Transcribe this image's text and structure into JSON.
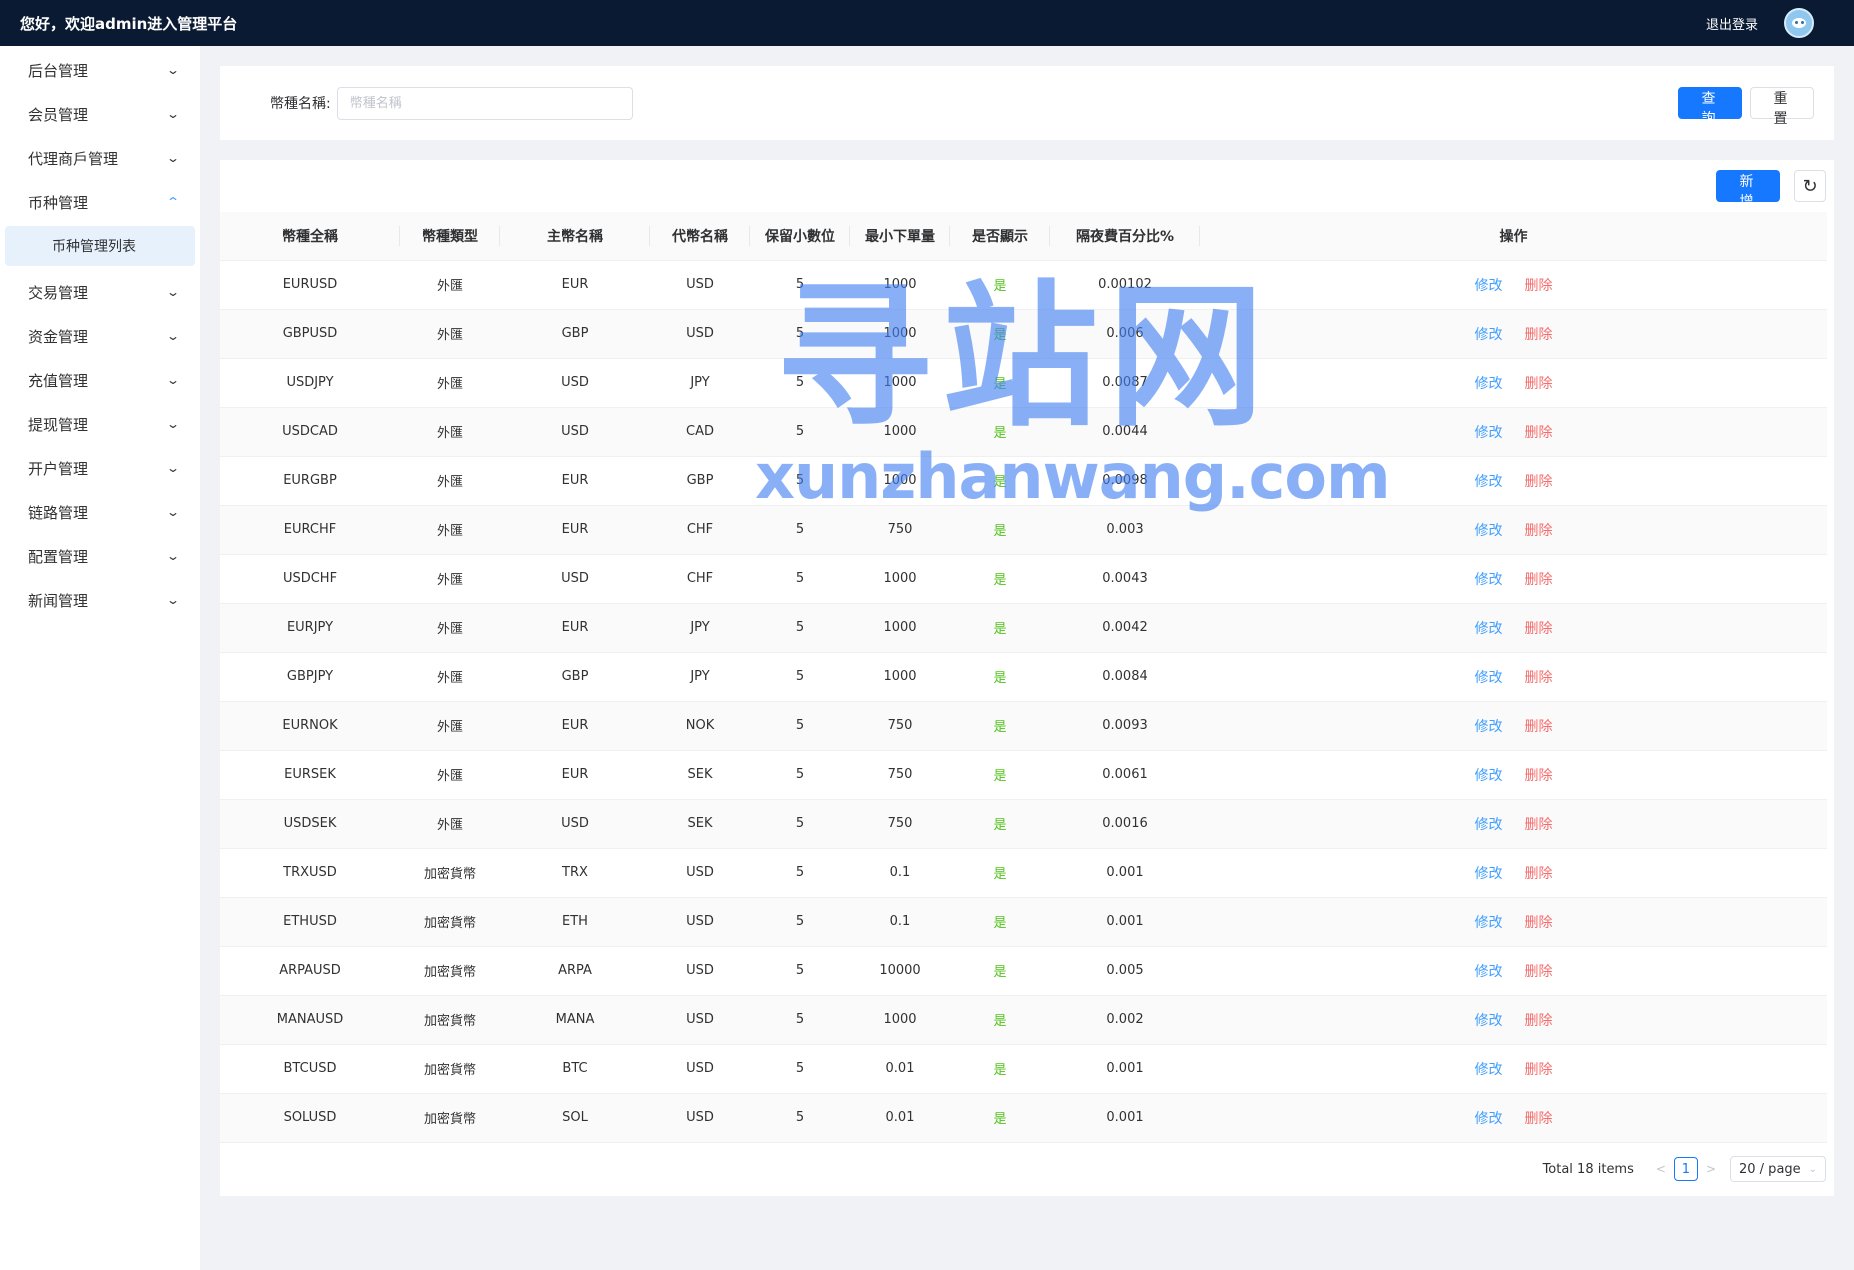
{
  "header": {
    "welcome": "您好，欢迎admin进入管理平台",
    "logout": "退出登录"
  },
  "sidebar": {
    "items": [
      {
        "label": "后台管理",
        "expanded": false
      },
      {
        "label": "会员管理",
        "expanded": false
      },
      {
        "label": "代理商戶管理",
        "expanded": false
      },
      {
        "label": "币种管理",
        "expanded": true
      },
      {
        "label": "交易管理",
        "expanded": false
      },
      {
        "label": "资金管理",
        "expanded": false
      },
      {
        "label": "充值管理",
        "expanded": false
      },
      {
        "label": "提现管理",
        "expanded": false
      },
      {
        "label": "开户管理",
        "expanded": false
      },
      {
        "label": "链路管理",
        "expanded": false
      },
      {
        "label": "配置管理",
        "expanded": false
      },
      {
        "label": "新闻管理",
        "expanded": false
      }
    ],
    "sub_active": "币种管理列表"
  },
  "search": {
    "label": "幣種名稱:",
    "placeholder": "幣種名稱",
    "query_label": "查詢",
    "reset_label": "重置"
  },
  "toolbar": {
    "add_label": "新增",
    "refresh_icon": "refresh-icon"
  },
  "table": {
    "columns": [
      "幣種全稱",
      "幣種類型",
      "主幣名稱",
      "代幣名稱",
      "保留小數位",
      "最小下單量",
      "是否顯示",
      "隔夜費百分比%",
      "操作"
    ],
    "edit_label": "修改",
    "delete_label": "删除",
    "rows": [
      [
        "EURUSD",
        "外匯",
        "EUR",
        "USD",
        "5",
        "1000",
        "是",
        "0.00102"
      ],
      [
        "GBPUSD",
        "外匯",
        "GBP",
        "USD",
        "5",
        "1000",
        "是",
        "0.006"
      ],
      [
        "USDJPY",
        "外匯",
        "USD",
        "JPY",
        "5",
        "1000",
        "是",
        "0.0087"
      ],
      [
        "USDCAD",
        "外匯",
        "USD",
        "CAD",
        "5",
        "1000",
        "是",
        "0.0044"
      ],
      [
        "EURGBP",
        "外匯",
        "EUR",
        "GBP",
        "5",
        "1000",
        "是",
        "0.0098"
      ],
      [
        "EURCHF",
        "外匯",
        "EUR",
        "CHF",
        "5",
        "750",
        "是",
        "0.003"
      ],
      [
        "USDCHF",
        "外匯",
        "USD",
        "CHF",
        "5",
        "1000",
        "是",
        "0.0043"
      ],
      [
        "EURJPY",
        "外匯",
        "EUR",
        "JPY",
        "5",
        "1000",
        "是",
        "0.0042"
      ],
      [
        "GBPJPY",
        "外匯",
        "GBP",
        "JPY",
        "5",
        "1000",
        "是",
        "0.0084"
      ],
      [
        "EURNOK",
        "外匯",
        "EUR",
        "NOK",
        "5",
        "750",
        "是",
        "0.0093"
      ],
      [
        "EURSEK",
        "外匯",
        "EUR",
        "SEK",
        "5",
        "750",
        "是",
        "0.0061"
      ],
      [
        "USDSEK",
        "外匯",
        "USD",
        "SEK",
        "5",
        "750",
        "是",
        "0.0016"
      ],
      [
        "TRXUSD",
        "加密貨幣",
        "TRX",
        "USD",
        "5",
        "0.1",
        "是",
        "0.001"
      ],
      [
        "ETHUSD",
        "加密貨幣",
        "ETH",
        "USD",
        "5",
        "0.1",
        "是",
        "0.001"
      ],
      [
        "ARPAUSD",
        "加密貨幣",
        "ARPA",
        "USD",
        "5",
        "10000",
        "是",
        "0.005"
      ],
      [
        "MANAUSD",
        "加密貨幣",
        "MANA",
        "USD",
        "5",
        "1000",
        "是",
        "0.002"
      ],
      [
        "BTCUSD",
        "加密貨幣",
        "BTC",
        "USD",
        "5",
        "0.01",
        "是",
        "0.001"
      ],
      [
        "SOLUSD",
        "加密貨幣",
        "SOL",
        "USD",
        "5",
        "0.01",
        "是",
        "0.001"
      ]
    ]
  },
  "pagination": {
    "total": "Total 18 items",
    "current": "1",
    "page_size": "20 / page"
  },
  "watermark": {
    "cn": "寻站网",
    "en": "xunzhanwang.com"
  },
  "colors": {
    "header_bg": "#0b1a33",
    "primary": "#1677ff",
    "edit": "#409eff",
    "delete": "#f56c6c",
    "yes": "#52c41a"
  }
}
